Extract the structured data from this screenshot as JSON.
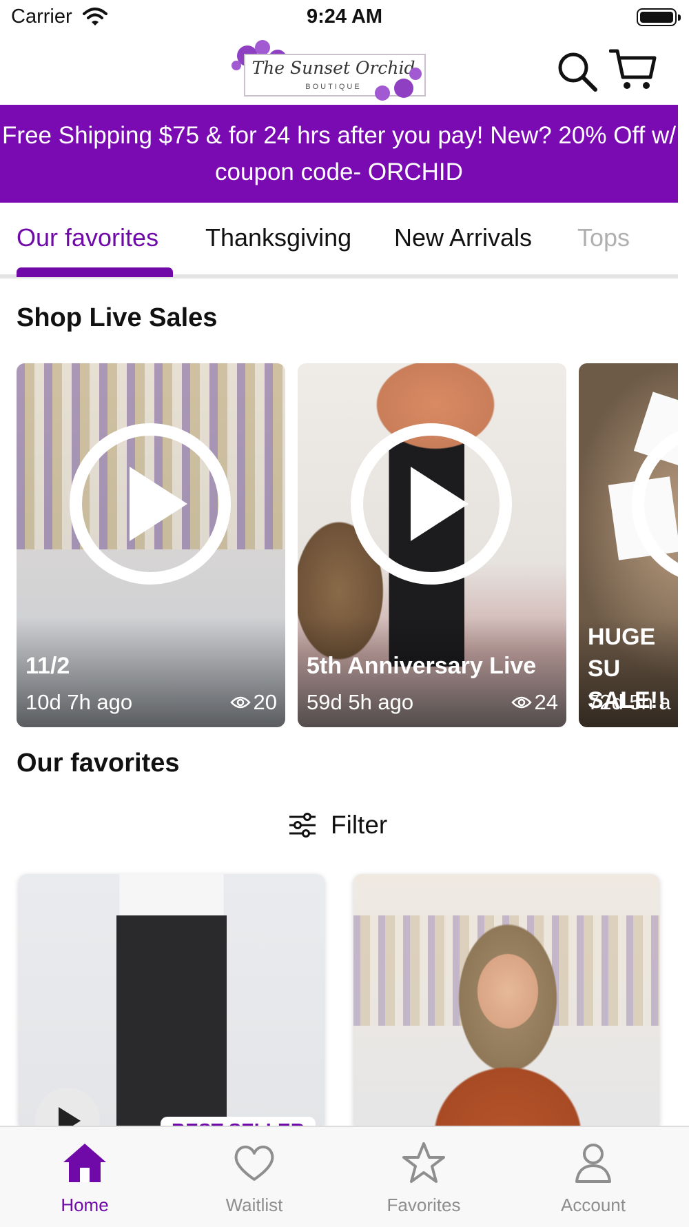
{
  "status_bar": {
    "carrier": "Carrier",
    "time": "9:24 AM"
  },
  "header": {
    "logo": {
      "title": "The Sunset Orchid",
      "subtitle": "BOUTIQUE"
    },
    "search_icon": "search-icon",
    "cart_icon": "cart-icon"
  },
  "promo": {
    "text": "Free Shipping $75 & for 24 hrs after you pay! New? 20% Off w/ coupon code- ORCHID"
  },
  "tabs": [
    {
      "label": "Our favorites",
      "active": true
    },
    {
      "label": "Thanksgiving"
    },
    {
      "label": "New Arrivals"
    },
    {
      "label": "Tops"
    }
  ],
  "live_sales": {
    "title": "Shop Live Sales",
    "cards": [
      {
        "title": "11/2",
        "age": "10d 7h ago",
        "views": "20"
      },
      {
        "title": "5th Anniversary Live",
        "age": "59d 5h ago",
        "views": "24"
      },
      {
        "title": "HUGE SU SALE!!",
        "age": "72d 5h a"
      }
    ]
  },
  "favorites": {
    "title": "Our favorites",
    "filter_label": "Filter",
    "products": [
      {
        "badge": "BEST SELLER"
      },
      {}
    ]
  },
  "bottom_nav": [
    {
      "label": "Home",
      "icon": "home-icon",
      "active": true
    },
    {
      "label": "Waitlist",
      "icon": "heart-icon"
    },
    {
      "label": "Favorites",
      "icon": "star-icon"
    },
    {
      "label": "Account",
      "icon": "person-icon"
    }
  ],
  "colors": {
    "brand": "#7a0bb3",
    "accent": "#6f0aa8",
    "inactive": "#8e8e8e"
  }
}
